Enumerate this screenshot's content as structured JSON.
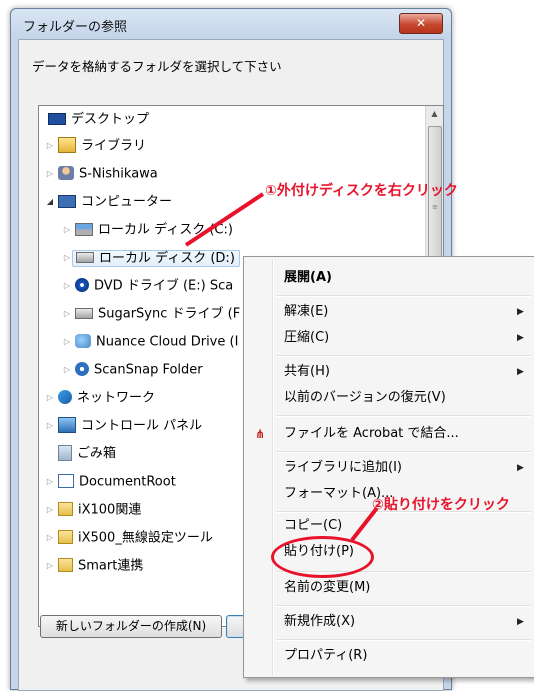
{
  "dialog": {
    "title": "フォルダーの参照",
    "close_label": "✕",
    "instruction": "データを格納するフォルダを選択して下さい",
    "new_folder_button": "新しいフォルダーの作成(N)"
  },
  "tree": [
    {
      "label": "デスクトップ",
      "icon": "desktop-icon",
      "arrow": ""
    },
    {
      "label": "ライブラリ",
      "icon": "library-icon",
      "arrow": "▷"
    },
    {
      "label": "S-Nishikawa",
      "icon": "user-icon",
      "arrow": "▷"
    },
    {
      "label": "コンピューター",
      "icon": "computer-icon",
      "arrow": "◢"
    },
    {
      "label": "ローカル ディスク (C:)",
      "icon": "hard-disk-icon",
      "arrow": "▷"
    },
    {
      "label": "ローカル ディスク (D:)",
      "icon": "hard-disk-icon",
      "arrow": "▷"
    },
    {
      "label": "DVD ドライブ (E:) Sca",
      "icon": "dvd-icon",
      "arrow": "▷"
    },
    {
      "label": "SugarSync ドライブ (F",
      "icon": "hard-disk-icon",
      "arrow": "▷"
    },
    {
      "label": "Nuance Cloud Drive (I",
      "icon": "cloud-drive-icon",
      "arrow": "▷"
    },
    {
      "label": "ScanSnap Folder",
      "icon": "scansnap-icon",
      "arrow": "▷"
    },
    {
      "label": "ネットワーク",
      "icon": "network-icon",
      "arrow": "▷"
    },
    {
      "label": "コントロール パネル",
      "icon": "control-panel-icon",
      "arrow": "▷"
    },
    {
      "label": "ごみ箱",
      "icon": "recycle-bin-icon",
      "arrow": ""
    },
    {
      "label": "DocumentRoot",
      "icon": "document-root-icon",
      "arrow": "▷"
    },
    {
      "label": "iX100関連",
      "icon": "folder-icon",
      "arrow": "▷"
    },
    {
      "label": "iX500_無線設定ツール",
      "icon": "folder-icon",
      "arrow": "▷"
    },
    {
      "label": "Smart連携",
      "icon": "folder-icon",
      "arrow": "▷"
    }
  ],
  "context_menu": {
    "items": [
      {
        "label": "展開(A)",
        "bold": true,
        "submenu": false
      },
      {
        "label": "解凍(E)",
        "submenu": true
      },
      {
        "label": "圧縮(C)",
        "submenu": true
      },
      {
        "label": "共有(H)",
        "submenu": true
      },
      {
        "label": "以前のバージョンの復元(V)",
        "submenu": false
      },
      {
        "label": "ファイルを Acrobat で結合...",
        "submenu": false,
        "icon": "acrobat-icon"
      },
      {
        "label": "ライブラリに追加(I)",
        "submenu": true
      },
      {
        "label": "フォーマット(A)...",
        "submenu": false
      },
      {
        "label": "コピー(C)",
        "submenu": false
      },
      {
        "label": "貼り付け(P)",
        "submenu": false
      },
      {
        "label": "名前の変更(M)",
        "submenu": false
      },
      {
        "label": "新規作成(X)",
        "submenu": true
      },
      {
        "label": "プロパティ(R)",
        "submenu": false
      }
    ]
  },
  "annotations": {
    "step1": "①外付けディスクを右クリック",
    "step2": "②貼り付けをクリック",
    "color": "#e8132a"
  }
}
